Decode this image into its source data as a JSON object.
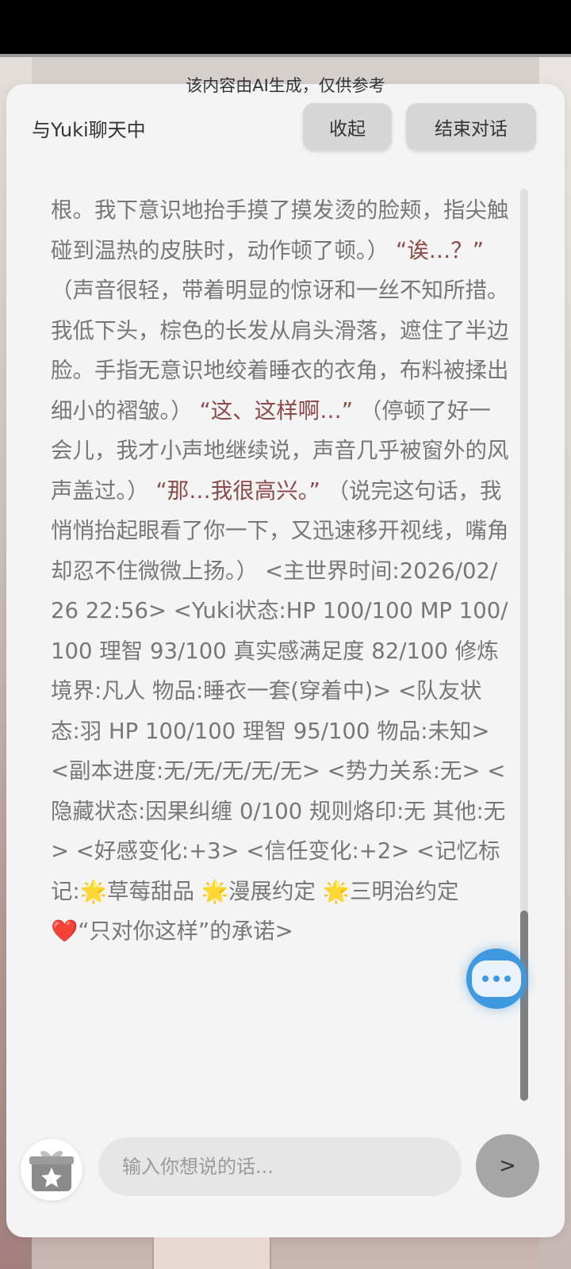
{
  "notice": "该内容由AI生成，仅供参考",
  "header": {
    "title": "与Yuki聊天中",
    "collapse_label": "收起",
    "end_label": "结束对话"
  },
  "message": {
    "p1": "根。我下意识地抬手摸了摸发烫的脸颊，指尖触碰到温热的皮肤时，动作顿了顿。）",
    "q1": "“诶…？”",
    "p2": "（声音很轻，带着明显的惊讶和一丝不知所措。我低下头，棕色的长发从肩头滑落，遮住了半边脸。手指无意识地绞着睡衣的衣角，布料被揉出细小的褶皱。）",
    "q2": "“这、这样啊…”",
    "p3": "（停顿了好一会儿，我才小声地继续说，声音几乎被窗外的风声盖过。）",
    "q3": "“那…我很高兴。”",
    "p4": "（说完这句话，我悄悄抬起眼看了你一下，又迅速移开视线，嘴角却忍不住微微上扬。）",
    "p5": "<主世界时间:2026/02/26 22:56> <Yuki状态:HP 100/100 MP 100/100 理智 93/100 真实感满足度 82/100 修炼境界:凡人 物品:睡衣一套(穿着中)> <队友状态:羽 HP 100/100 理智 95/100 物品:未知> <副本进度:无/无/无/无/无> <势力关系:无> <隐藏状态:因果纠缠 0/100 规则烙印:无 其他:无> <好感变化:+3> <信任变化:+2> <记忆标记:🌟草莓甜品 🌟漫展约定 🌟三明治约定 ❤️“只对你这样”的承诺>"
  },
  "composer": {
    "placeholder": "输入你想说的话...",
    "send_label": ">"
  },
  "colors": {
    "panel": "#f4f4f4",
    "quote": "#8b4a4a",
    "bubble": "#3f99df"
  }
}
